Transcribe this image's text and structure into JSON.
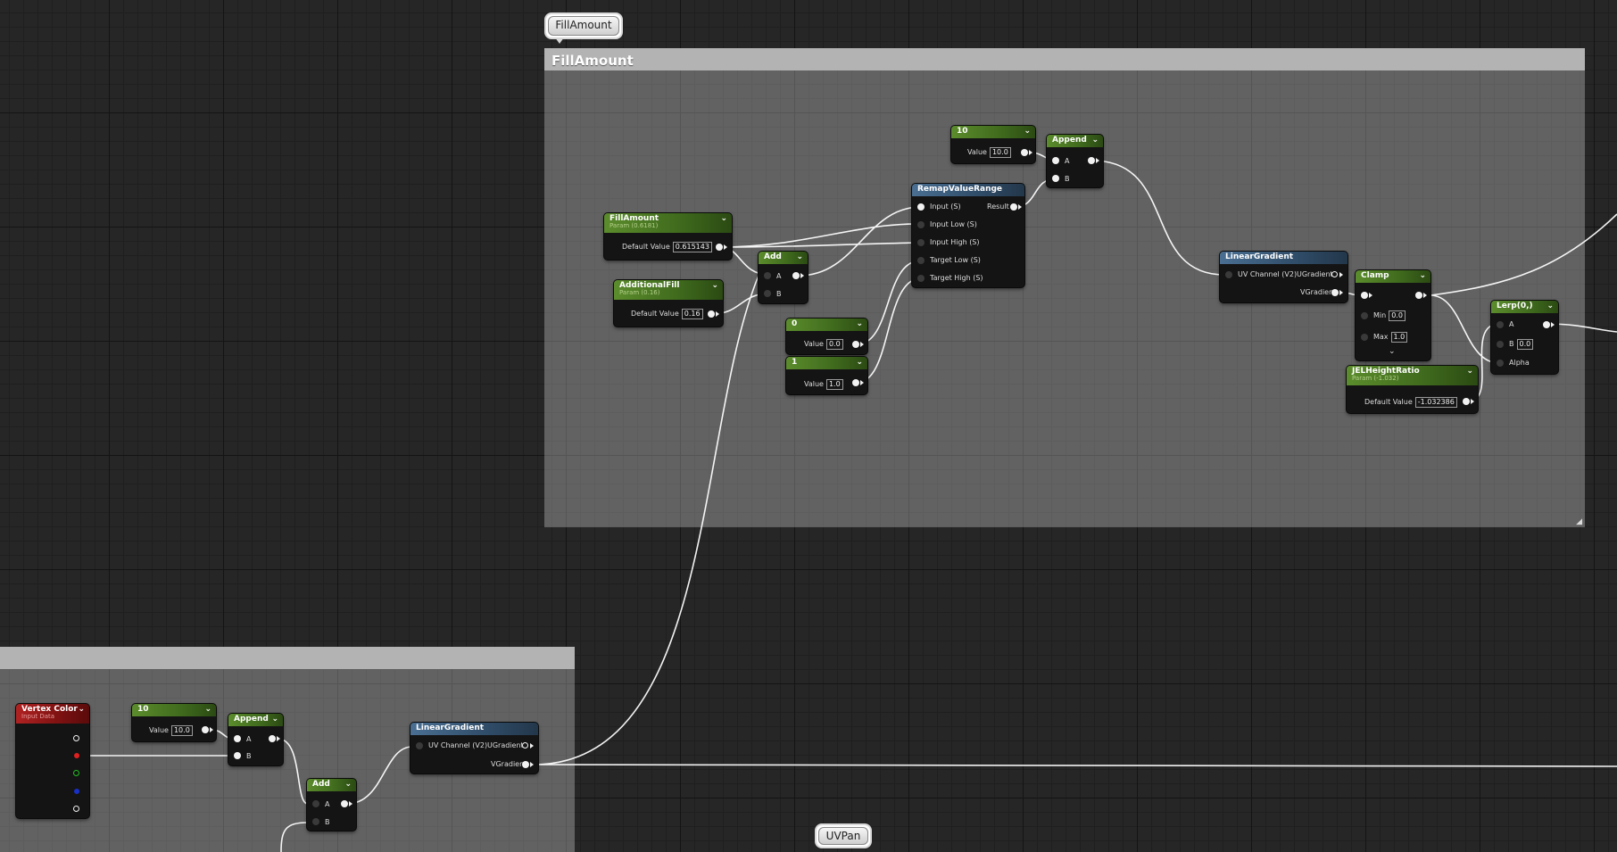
{
  "comments": {
    "fillamount_bubble": "FillAmount",
    "fillamount_title": "FillAmount",
    "uvpan_bubble": "UVPan"
  },
  "nodes": {
    "const10_top": {
      "title": "10",
      "value_label": "Value",
      "value": "10.0"
    },
    "append_top": {
      "title": "Append",
      "pin_a": "A",
      "pin_b": "B"
    },
    "remap": {
      "title": "RemapValueRange",
      "in1": "Input (S)",
      "result": "Result",
      "in2": "Input Low (S)",
      "in3": "Input High (S)",
      "in4": "Target Low (S)",
      "in5": "Target High (S)"
    },
    "fillamount_param": {
      "title": "FillAmount",
      "subtitle": "Param (0.6181)",
      "value_label": "Default Value",
      "value": "0.615143"
    },
    "additionalfill_param": {
      "title": "AdditionalFill",
      "subtitle": "Param (0.16)",
      "value_label": "Default Value",
      "value": "0.16"
    },
    "add_top": {
      "title": "Add",
      "pin_a": "A",
      "pin_b": "B"
    },
    "const0": {
      "title": "0",
      "value_label": "Value",
      "value": "0.0"
    },
    "const1": {
      "title": "1",
      "value_label": "Value",
      "value": "1.0"
    },
    "lineargradient_top": {
      "title": "LinearGradient",
      "in": "UV Channel (V2)",
      "out1": "UGradient",
      "out2": "VGradient"
    },
    "clamp": {
      "title": "Clamp",
      "min_label": "Min",
      "min": "0.0",
      "max_label": "Max",
      "max": "1.0"
    },
    "lerp": {
      "title": "Lerp(0,)",
      "pin_a": "A",
      "pin_b": "B",
      "b_value": "0.0",
      "alpha": "Alpha"
    },
    "jelheight": {
      "title": "JELHeightRatio",
      "subtitle": "Param (-1.032)",
      "value_label": "Default Value",
      "value": "-1.032386"
    },
    "vertexcolor": {
      "title": "Vertex Color",
      "subtitle": "Input Data"
    },
    "const10_bottom": {
      "title": "10",
      "value_label": "Value",
      "value": "10.0"
    },
    "append_bottom": {
      "title": "Append",
      "pin_a": "A",
      "pin_b": "B"
    },
    "add_bottom": {
      "title": "Add",
      "pin_a": "A",
      "pin_b": "B"
    },
    "lineargradient_bottom": {
      "title": "LinearGradient",
      "in": "UV Channel (V2)",
      "out1": "UGradient",
      "out2": "VGradient"
    }
  },
  "colors": {
    "grid_bg": "#262626",
    "comment_bar": "#b3b3b3",
    "param_header": "#5b8c2c",
    "function_header": "#4a6f92",
    "vertex_header": "#b02222",
    "wire": "#f2f2f2"
  }
}
